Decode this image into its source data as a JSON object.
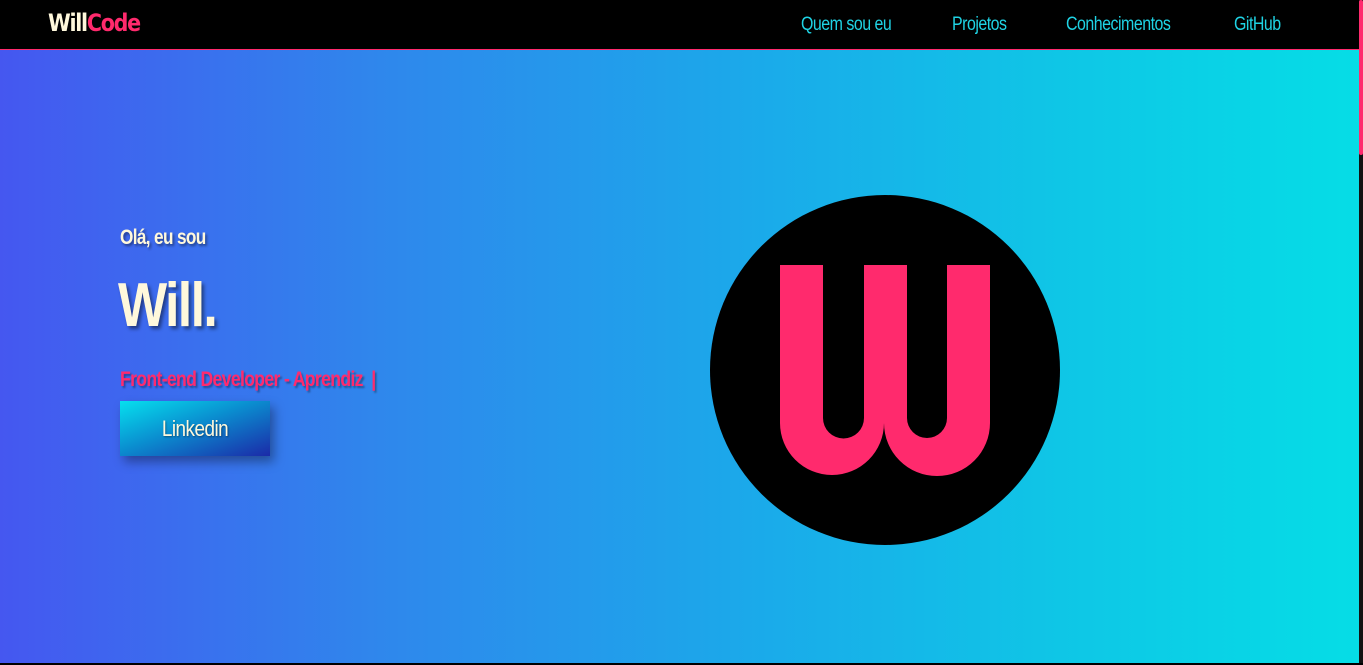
{
  "navbar": {
    "logo_will": "Will",
    "logo_code": "Code",
    "links": [
      {
        "label": "Quem sou eu"
      },
      {
        "label": "Projetos"
      },
      {
        "label": "Conhecimentos"
      },
      {
        "label": "GitHub"
      }
    ]
  },
  "hero": {
    "greeting": "Olá, eu sou",
    "name": "Will.",
    "role": "Front-end Developer - Aprendiz",
    "cursor": "|",
    "linkedin_label": "Linkedin",
    "logo_icon": "w-monogram-icon"
  },
  "colors": {
    "accent": "#ff2a6d",
    "nav_link": "#1fd3e4",
    "cream": "#fff8dc",
    "gradient_start": "#4557f0",
    "gradient_end": "#05dde6",
    "background": "#000000"
  }
}
